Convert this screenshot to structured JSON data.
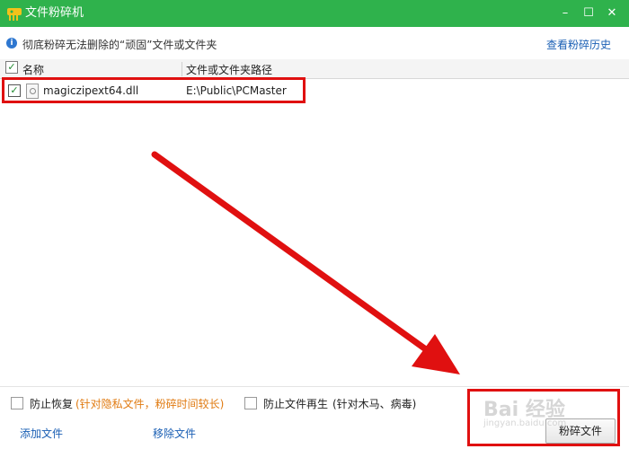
{
  "window": {
    "title": "文件粉碎机",
    "icon": "shredder-app-icon",
    "minimize_symbol": "–",
    "maximize_symbol": "☐",
    "close_symbol": "✕"
  },
  "info_bar": {
    "icon_glyph": "i",
    "text": "彻底粉碎无法删除的“顽固”文件或文件夹",
    "history_link": "查看粉碎历史"
  },
  "table": {
    "header_check": "✓",
    "columns": [
      "名称",
      "文件或文件夹路径"
    ],
    "rows": [
      {
        "checked": true,
        "check_glyph": "✓",
        "name": "magiczipext64.dll",
        "path": "E:\\Public\\PCMaster"
      }
    ]
  },
  "options": {
    "prevent_recovery": "防止恢复",
    "prevent_recovery_note": "(针对隐私文件，粉碎时间较长)",
    "prevent_regeneration": "防止文件再生",
    "prevent_regeneration_note": "(针对木马、病毒)"
  },
  "actions": {
    "add_file": "添加文件",
    "remove_file": "移除文件",
    "shred_file": "粉碎文件"
  },
  "watermark": {
    "logo": "Bai 经验",
    "sub": "jingyan.baidu.com"
  },
  "colors": {
    "titlebar": "#2fb24c",
    "link": "#1a5fb4",
    "annotation_red": "#e01010",
    "note_orange": "#e07a10"
  }
}
